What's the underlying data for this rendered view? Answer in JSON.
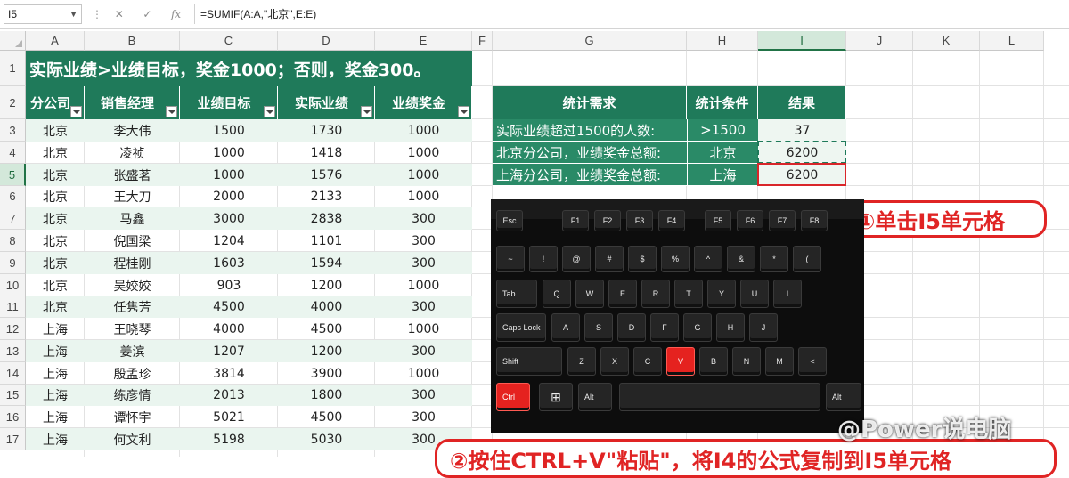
{
  "formula_bar": {
    "name_box": "I5",
    "cancel_icon": "✕",
    "enter_icon": "✓",
    "fx_icon": "fx",
    "formula": "=SUMIF(A:A,\"北京\",E:E)"
  },
  "columns": [
    "A",
    "B",
    "C",
    "D",
    "E",
    "F",
    "G",
    "H",
    "I",
    "J",
    "K",
    "L"
  ],
  "rows": [
    "1",
    "2",
    "3",
    "4",
    "5",
    "6",
    "7",
    "8",
    "9",
    "10",
    "11",
    "12",
    "13",
    "14",
    "15",
    "16",
    "17"
  ],
  "title": "实际业绩>业绩目标，奖金1000；否则，奖金300。",
  "headers": [
    "分公司",
    "销售经理",
    "业绩目标",
    "实际业绩",
    "业绩奖金"
  ],
  "data": [
    [
      "北京",
      "李大伟",
      "1500",
      "1730",
      "1000"
    ],
    [
      "北京",
      "凌祯",
      "1000",
      "1418",
      "1000"
    ],
    [
      "北京",
      "张盛茗",
      "1000",
      "1576",
      "1000"
    ],
    [
      "北京",
      "王大刀",
      "2000",
      "2133",
      "1000"
    ],
    [
      "北京",
      "马鑫",
      "3000",
      "2838",
      "300"
    ],
    [
      "北京",
      "倪国梁",
      "1204",
      "1101",
      "300"
    ],
    [
      "北京",
      "程桂刚",
      "1603",
      "1594",
      "300"
    ],
    [
      "北京",
      "吴姣姣",
      "903",
      "1200",
      "1000"
    ],
    [
      "北京",
      "任隽芳",
      "4500",
      "4000",
      "300"
    ],
    [
      "上海",
      "王晓琴",
      "4000",
      "4500",
      "1000"
    ],
    [
      "上海",
      "姜滨",
      "1207",
      "1200",
      "300"
    ],
    [
      "上海",
      "殷孟珍",
      "3814",
      "3900",
      "1000"
    ],
    [
      "上海",
      "练彦情",
      "2013",
      "1800",
      "300"
    ],
    [
      "上海",
      "谭怀宇",
      "5021",
      "4500",
      "300"
    ],
    [
      "上海",
      "何文利",
      "5198",
      "5030",
      "300"
    ]
  ],
  "stats": {
    "headers": [
      "统计需求",
      "统计条件",
      "结果"
    ],
    "rows": [
      {
        "label": "实际业绩超过1500的人数:",
        "cond": ">1500",
        "result": "37"
      },
      {
        "label": "北京分公司，业绩奖金总额:",
        "cond": "北京",
        "result": "6200"
      },
      {
        "label": "上海分公司，业绩奖金总额:",
        "cond": "上海",
        "result": "6200"
      }
    ]
  },
  "callout1": "①单击I5单元格",
  "callout2": "②按住CTRL+V\"粘贴\"，将I4的公式复制到I5单元格",
  "watermark": "@Power说电脑",
  "keyboard": {
    "row0": [
      "Esc",
      "F1",
      "F2",
      "F3",
      "F4",
      "F5",
      "F6",
      "F7",
      "F8"
    ],
    "row1": [
      "~",
      "!",
      "@",
      "#",
      "$",
      "%",
      "^",
      "&",
      "*",
      "("
    ],
    "row2": [
      "Tab",
      "Q",
      "W",
      "E",
      "R",
      "T",
      "Y",
      "U",
      "I"
    ],
    "row3": [
      "Caps Lock",
      "A",
      "S",
      "D",
      "F",
      "G",
      "H",
      "J"
    ],
    "row4": [
      "Shift",
      "Z",
      "X",
      "C",
      "V",
      "B",
      "N",
      "M",
      "<"
    ],
    "row5": [
      "Ctrl",
      "Alt",
      "Alt"
    ],
    "win_icon": "⊞",
    "highlight": "red"
  },
  "colors": {
    "header_green": "#1f7a5a",
    "highlight_red": "#e02424"
  }
}
